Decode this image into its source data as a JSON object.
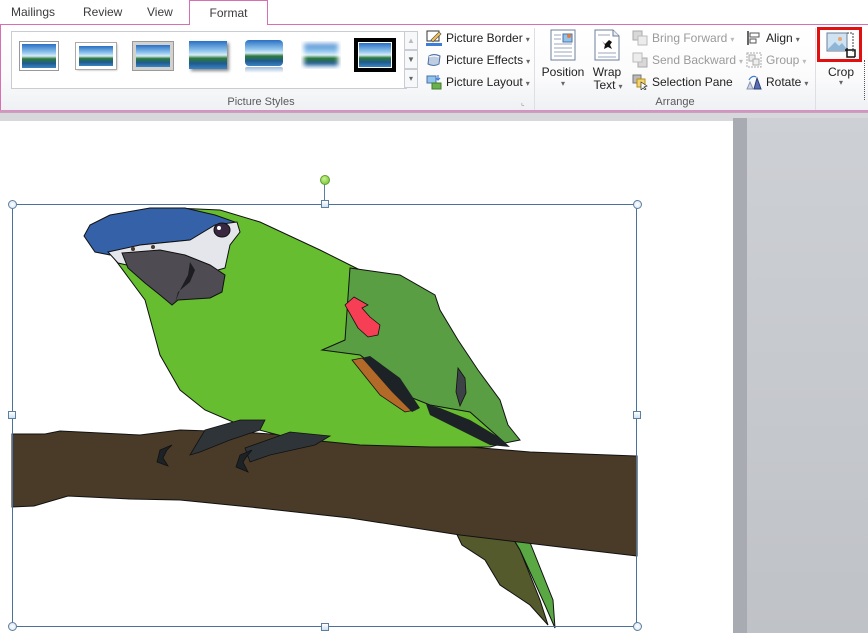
{
  "tabs": [
    {
      "label": "Mailings",
      "active": false
    },
    {
      "label": "Review",
      "active": false
    },
    {
      "label": "View",
      "active": false
    },
    {
      "label": "Format",
      "active": true
    }
  ],
  "ribbon": {
    "picture_styles": {
      "group_label": "Picture Styles",
      "gallery_items": [
        "Simple Frame, White",
        "Beveled Matte, White",
        "Metal Frame",
        "Drop Shadow Rectangle",
        "Reflected Rounded Rectangle",
        "Soft Edge Rectangle",
        "Double Frame, Black"
      ],
      "scroll_up_label": "▲",
      "scroll_down_label": "▼",
      "more_label": "▾",
      "commands": [
        {
          "label": "Picture Border",
          "icon": "picture-border-icon",
          "has_dropdown": true
        },
        {
          "label": "Picture Effects",
          "icon": "picture-effects-icon",
          "has_dropdown": true
        },
        {
          "label": "Picture Layout",
          "icon": "picture-layout-icon",
          "has_dropdown": true
        }
      ],
      "dialog_launcher_label": "⌞"
    },
    "arrange": {
      "group_label": "Arrange",
      "position_label": "Position",
      "wrap_text_label_1": "Wrap",
      "wrap_text_label_2": "Text",
      "commands": [
        {
          "label": "Bring Forward",
          "icon": "bring-forward-icon",
          "has_dropdown": true,
          "enabled": false
        },
        {
          "label": "Send Backward",
          "icon": "send-backward-icon",
          "has_dropdown": true,
          "enabled": false
        },
        {
          "label": "Selection Pane",
          "icon": "selection-pane-icon",
          "has_dropdown": false,
          "enabled": true
        }
      ],
      "align_commands": [
        {
          "label": "Align",
          "icon": "align-icon",
          "has_dropdown": true,
          "enabled": true
        },
        {
          "label": "Group",
          "icon": "group-icon",
          "has_dropdown": true,
          "enabled": false
        },
        {
          "label": "Rotate",
          "icon": "rotate-icon",
          "has_dropdown": true,
          "enabled": true
        }
      ]
    },
    "size": {
      "crop_label": "Crop",
      "crop_highlighted": true
    },
    "caret": "▾"
  },
  "document": {
    "image_description": "Cartoon green parrot perched on a brown branch",
    "selected": true
  },
  "colors": {
    "tab_accent": "#d86fb4",
    "highlight": "#e01010",
    "parrot_green": "#66bd2f",
    "wing_green": "#5a9e43",
    "head_blue": "#3461a8",
    "branch_brown": "#4a3b28"
  }
}
